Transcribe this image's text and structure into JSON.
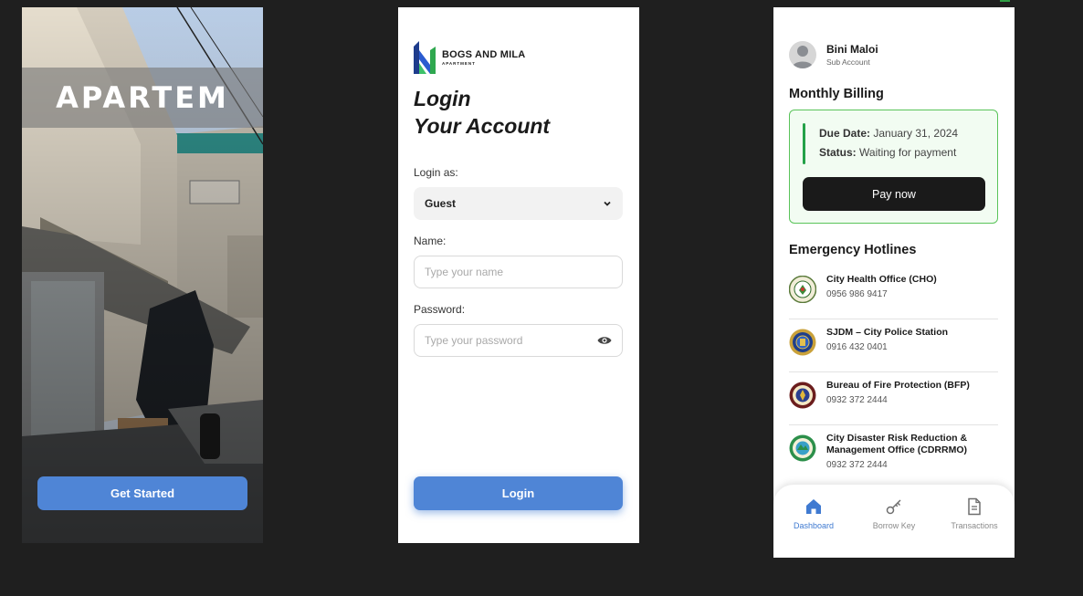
{
  "splash": {
    "app_title": "APARTEM",
    "cta_label": "Get Started",
    "accent_color": "#4f85d6"
  },
  "login": {
    "brand_name": "BOGS AND MILA",
    "brand_sub": "APARTMENT",
    "heading_line1": "Login",
    "heading_line2": "Your Account",
    "login_as_label": "Login as:",
    "login_as_value": "Guest",
    "name_label": "Name:",
    "name_placeholder": "Type your name",
    "password_label": "Password:",
    "password_placeholder": "Type your password",
    "login_button": "Login"
  },
  "dashboard": {
    "user_name": "Bini Maloi",
    "user_role": "Sub Account",
    "billing_title": "Monthly Billing",
    "due_label": "Due Date:",
    "due_value": "January 31, 2024",
    "status_label": "Status:",
    "status_value": "Waiting for payment",
    "pay_button": "Pay now",
    "hotlines_title": "Emergency Hotlines",
    "hotlines": [
      {
        "name": "City Health Office (CHO)",
        "number": "0956 986 9417",
        "icon": "cho-seal-icon"
      },
      {
        "name": "SJDM – City Police Station",
        "number": "0916 432 0401",
        "icon": "police-seal-icon"
      },
      {
        "name": "Bureau of Fire Protection (BFP)",
        "number": "0932 372 2444",
        "icon": "bfp-seal-icon"
      },
      {
        "name": "City Disaster Risk Reduction &",
        "name2": "Management Office (CDRRMO)",
        "number": "0932 372 2444",
        "icon": "cdrrmo-seal-icon"
      }
    ],
    "nav": [
      {
        "label": "Dashboard",
        "icon": "home-icon",
        "active": true
      },
      {
        "label": "Borrow Key",
        "icon": "key-icon",
        "active": false
      },
      {
        "label": "Transactions",
        "icon": "document-icon",
        "active": false
      }
    ],
    "active_color": "#3f7ad1"
  }
}
